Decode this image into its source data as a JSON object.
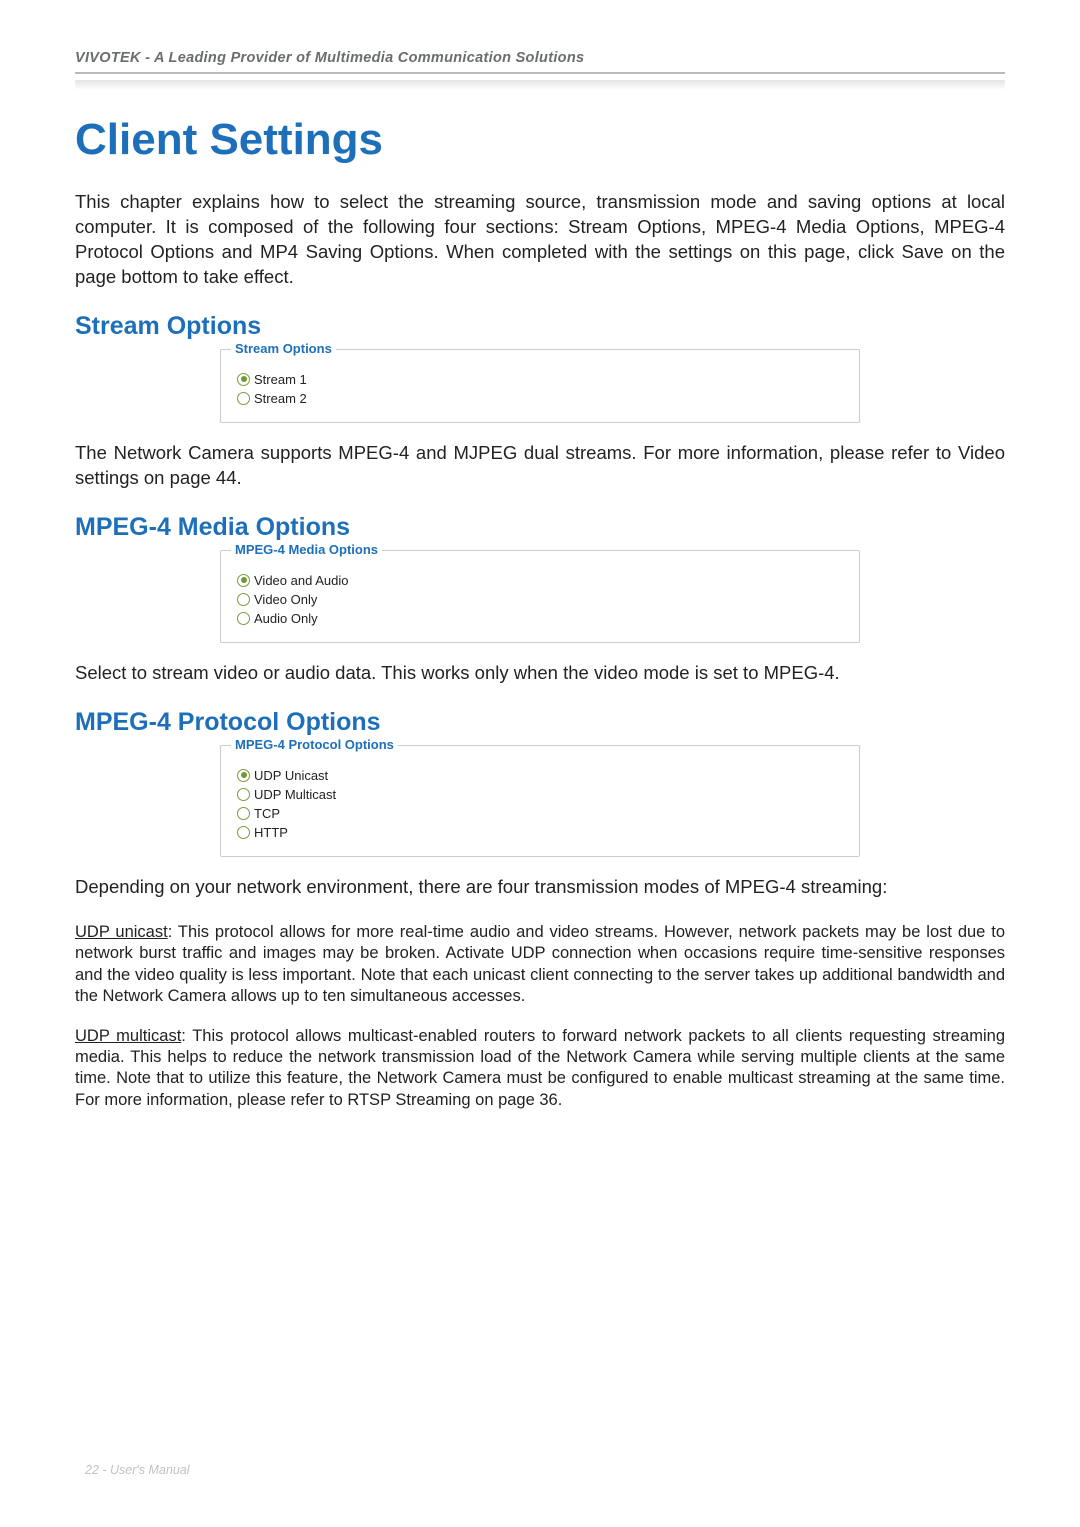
{
  "header": {
    "brand_line": "VIVOTEK - A Leading Provider of Multimedia Communication Solutions"
  },
  "title": "Client Settings",
  "intro": "This chapter explains how to select the streaming source, transmission mode and saving options at local computer. It is composed of the following four sections: Stream Options, MPEG-4 Media Options, MPEG-4 Protocol Options and MP4 Saving Options. When completed with the settings on this page, click Save on the page bottom to take effect.",
  "sections": {
    "stream": {
      "heading": "Stream Options",
      "legend": "Stream Options",
      "options": [
        {
          "label": "Stream 1",
          "selected": true
        },
        {
          "label": "Stream 2",
          "selected": false
        }
      ],
      "desc": "The Network Camera supports MPEG-4 and MJPEG dual streams. For more information, please refer to Video settings on page 44."
    },
    "media": {
      "heading": "MPEG-4 Media Options",
      "legend": "MPEG-4 Media Options",
      "options": [
        {
          "label": "Video and Audio",
          "selected": true
        },
        {
          "label": "Video Only",
          "selected": false
        },
        {
          "label": "Audio Only",
          "selected": false
        }
      ],
      "desc": "Select to stream video or audio data. This works only when the video mode is set to MPEG-4."
    },
    "protocol": {
      "heading": "MPEG-4 Protocol Options",
      "legend": "MPEG-4 Protocol Options",
      "options": [
        {
          "label": "UDP Unicast",
          "selected": true
        },
        {
          "label": "UDP Multicast",
          "selected": false
        },
        {
          "label": "TCP",
          "selected": false
        },
        {
          "label": "HTTP",
          "selected": false
        }
      ],
      "desc_lead": "Depending on your network environment, there are four transmission modes of MPEG-4 streaming:",
      "udp_unicast_label": "UDP unicast",
      "udp_unicast_body": ": This protocol allows for more real-time audio and video streams. However, network packets may be lost due to network burst traffic and images may be broken. Activate UDP connection when occasions require time-sensitive responses and the video quality is less important. Note that each unicast client connecting to the server takes up additional bandwidth and the Network Camera allows up to ten simultaneous accesses.",
      "udp_multicast_label": "UDP multicast",
      "udp_multicast_body": ": This protocol allows multicast-enabled routers to forward network packets to all clients requesting streaming media. This helps to reduce the network transmission load of the Network Camera while serving multiple clients at the same time. Note that to utilize this feature, the Network Camera must be configured to enable multicast streaming at the same time. For more information, please refer to RTSP Streaming on page 36."
    }
  },
  "footer": "22 - User's Manual"
}
